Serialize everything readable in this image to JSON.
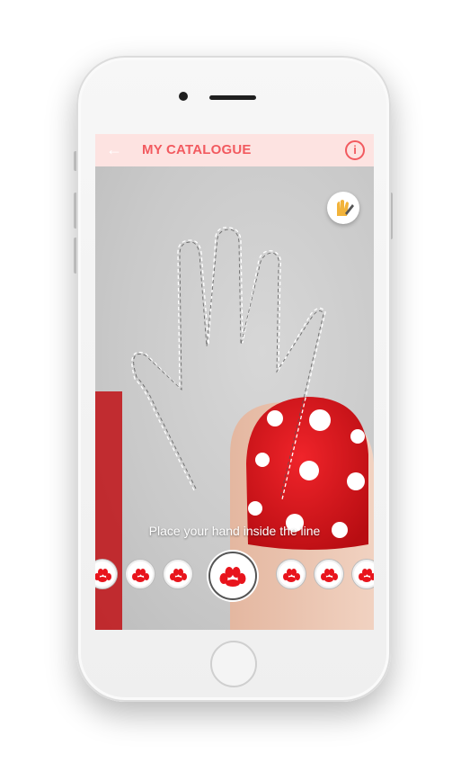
{
  "header": {
    "title": "MY CATALOGUE",
    "back_icon": "arrow-left-icon",
    "info_icon": "info-icon",
    "background": "#fde3e1",
    "accent": "#f25a5f"
  },
  "camera": {
    "hint": "Place your hand inside the line",
    "fab_icon": "hand-brush-icon",
    "swatches": [
      {
        "name": "swatch-1",
        "icon": "nails-icon",
        "color": "#e8141c"
      },
      {
        "name": "swatch-2",
        "icon": "nails-icon",
        "color": "#e8141c"
      },
      {
        "name": "swatch-3",
        "icon": "nails-icon",
        "color": "#e8141c"
      },
      {
        "name": "swatch-selected",
        "icon": "nails-icon",
        "color": "#e8141c"
      },
      {
        "name": "swatch-5",
        "icon": "nails-icon",
        "color": "#e8141c"
      },
      {
        "name": "swatch-6",
        "icon": "nails-icon",
        "color": "#e8141c"
      },
      {
        "name": "swatch-7",
        "icon": "nails-icon",
        "color": "#e8141c"
      }
    ]
  }
}
